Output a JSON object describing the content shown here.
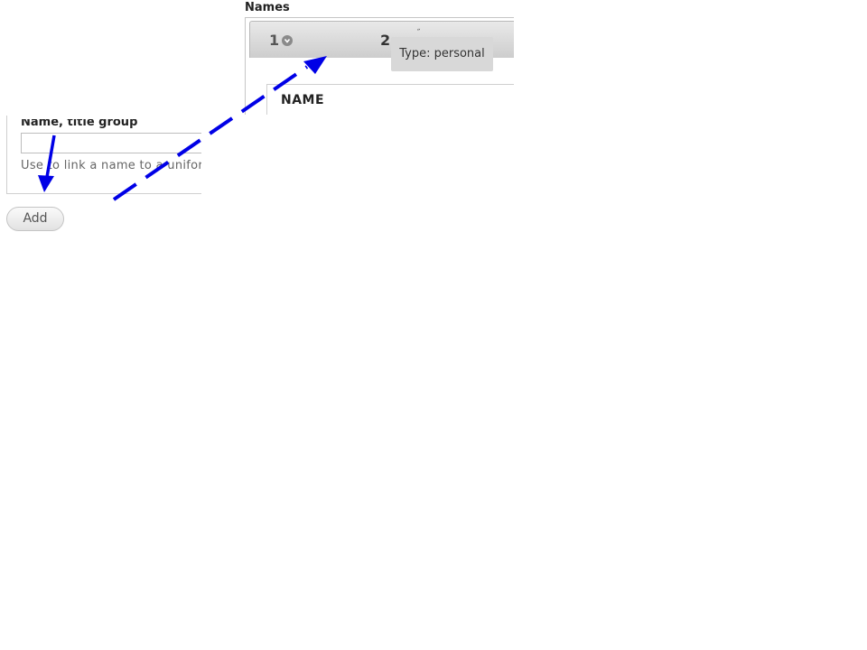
{
  "names": {
    "section_label": "Names",
    "tabs": [
      {
        "label": "1"
      },
      {
        "label": "2"
      }
    ],
    "tab2_marks": "˝",
    "tooltip": "Type: personal",
    "column_header": "NAME"
  },
  "form": {
    "field_label": "Name, title group",
    "help_text": "Use to link a name to a unifor",
    "add_label": "Add"
  },
  "colors": {
    "arrow": "#0000e6",
    "tab_bar": "#d6d6d6",
    "tooltip_bg": "#d8d8d8"
  }
}
